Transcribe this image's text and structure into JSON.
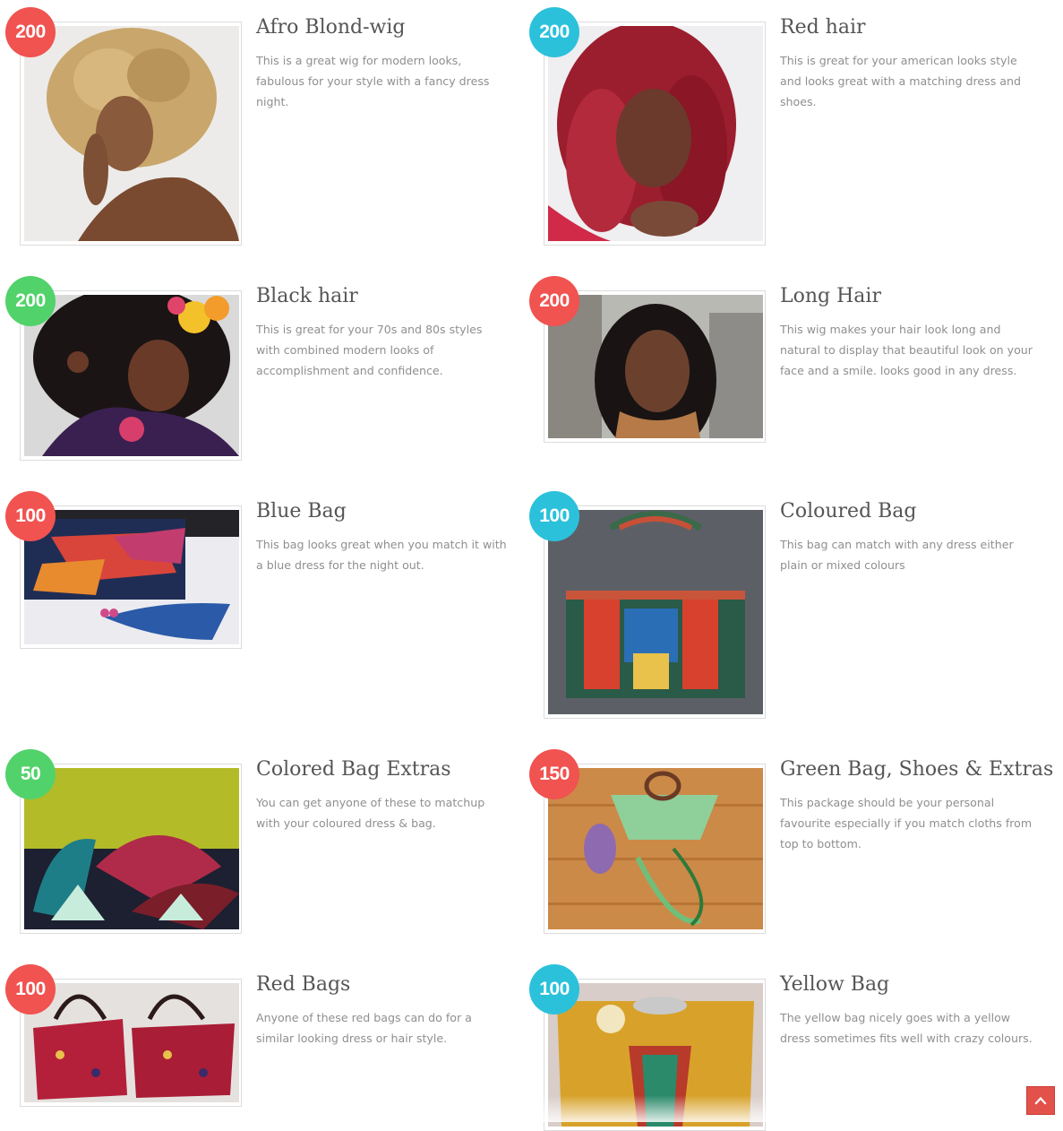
{
  "badge_colors": {
    "red": "#f05350",
    "cyan": "#2cc1db",
    "green": "#52d26a"
  },
  "scroll_top": {
    "icon": "chevron-up-icon"
  },
  "products": [
    {
      "price": "200",
      "color": "red",
      "title": "Afro Blond-wig",
      "description": "This is a great wig for modern looks, fabulous for your style with a fancy dress night.",
      "image": "woman with curly blond afro wig"
    },
    {
      "price": "200",
      "color": "cyan",
      "title": "Red hair",
      "description": "This is great for your american looks style and looks great with a matching dress and shoes.",
      "image": "woman with curly red hair"
    },
    {
      "price": "200",
      "color": "green",
      "title": "Black hair",
      "description": "This is great for your 70s and 80s styles with combined modern looks of accomplishment and confidence.",
      "image": "woman with black afro and flowers"
    },
    {
      "price": "200",
      "color": "red",
      "title": "Long Hair",
      "description": "This wig makes your hair look long and natural to display that beautiful look on your face and a smile. looks good in any dress.",
      "image": "smiling woman with long black hair"
    },
    {
      "price": "100",
      "color": "red",
      "title": "Blue Bag",
      "description": "This bag looks great when you match it with a blue dress for the night out.",
      "image": "blue patterned clutch bag"
    },
    {
      "price": "100",
      "color": "cyan",
      "title": "Coloured Bag",
      "description": "This bag can match with any dress either plain or mixed colours",
      "image": "multicoloured print handbag"
    },
    {
      "price": "50",
      "color": "green",
      "title": "Colored Bag Extras",
      "description": "You can get anyone of these to matchup with your coloured dress & bag.",
      "image": "printed hand fans"
    },
    {
      "price": "150",
      "color": "red",
      "title": "Green Bag, Shoes & Extras",
      "description": "This package should be your personal favourite especially if you match cloths from top to bottom.",
      "image": "green bag shoes and beads set"
    },
    {
      "price": "100",
      "color": "red",
      "title": "Red Bags",
      "description": "Anyone of these red bags can do for a similar looking dress or hair style.",
      "image": "two red star print bags"
    },
    {
      "price": "100",
      "color": "cyan",
      "title": "Yellow Bag",
      "description": "The yellow bag nicely goes with a yellow dress sometimes fits well with crazy colours.",
      "image": "yellow dashiki print bag"
    }
  ]
}
